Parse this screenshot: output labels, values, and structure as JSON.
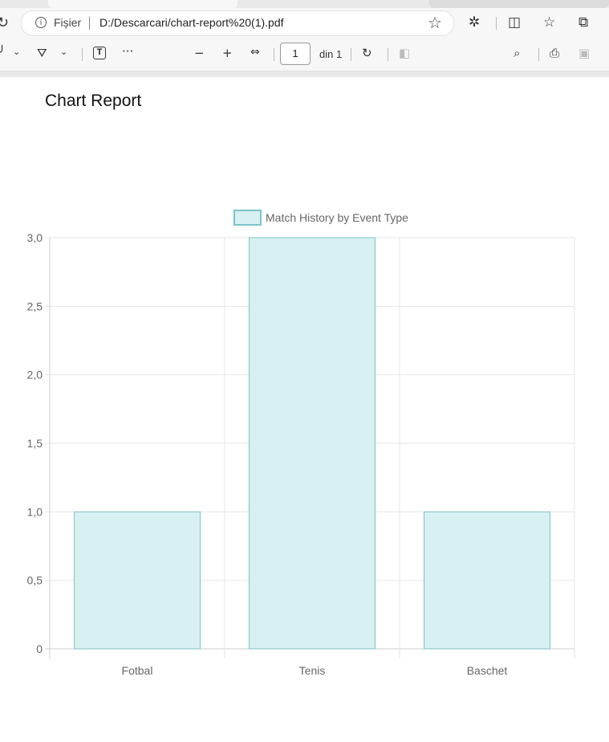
{
  "browser": {
    "url_scheme_label": "Fișier",
    "url": "D:/Descarcari/chart-report%20(1).pdf"
  },
  "pdf_toolbar": {
    "page_number": "1",
    "page_count_label": "din 1"
  },
  "document": {
    "title": "Chart Report"
  },
  "chart_data": {
    "type": "bar",
    "categories": [
      "Fotbal",
      "Tenis",
      "Baschet"
    ],
    "series": [
      {
        "name": "Match History by Event Type",
        "values": [
          1,
          3,
          1
        ]
      }
    ],
    "ylim": [
      0,
      3
    ],
    "yticks": [
      0,
      0.5,
      1,
      1.5,
      2,
      2.5,
      3
    ],
    "ytick_labels": [
      "0",
      "0,5",
      "1,0",
      "1,5",
      "2,0",
      "2,5",
      "3,0"
    ],
    "grid": true,
    "legend_position": "top",
    "colors": {
      "bar_fill": "#d8f0f2",
      "bar_stroke": "#7cc4c8",
      "grid": "#e6e6e6"
    }
  }
}
